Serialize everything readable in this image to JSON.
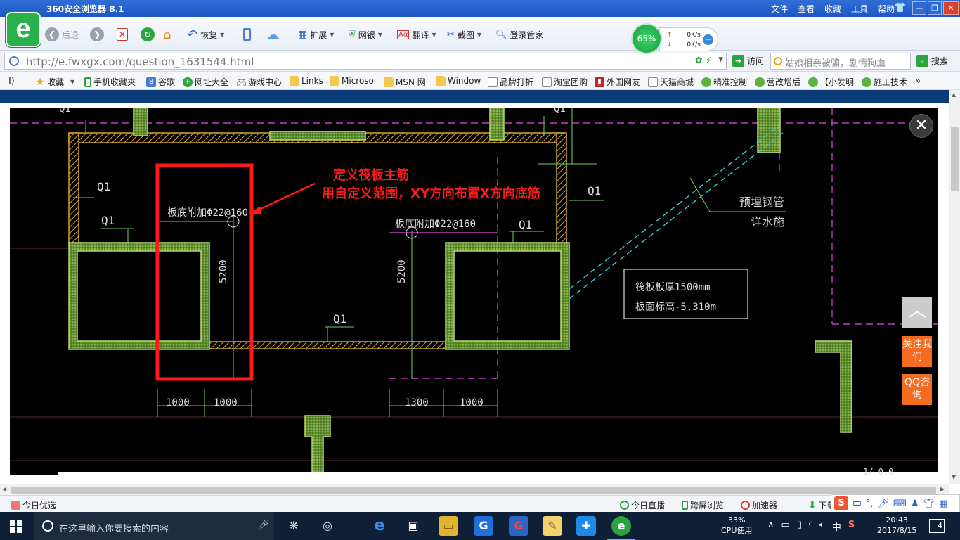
{
  "window": {
    "title": "360安全浏览器 8.1",
    "menu": [
      "文件",
      "查看",
      "收藏",
      "工具",
      "帮助"
    ],
    "logo_letter": "e"
  },
  "toolbar": {
    "back_label": "后退",
    "restore_label": "恢复",
    "extend_label": "扩展",
    "netbank_label": "网银",
    "translate_label": "翻译",
    "screenshot_label": "截图",
    "login_label": "登录管家"
  },
  "net_monitor": {
    "percent": "65%",
    "up_rate": "0K/s",
    "down_rate": "0K/s"
  },
  "address": {
    "url": "http://e.fwxgx.com/question_1631544.html",
    "visit_label": "访问",
    "search_text": "姑娘相亲被骗，剧情狗血",
    "search_label": "搜索"
  },
  "favorites": [
    {
      "label": "收藏",
      "icon": "star-icon"
    },
    {
      "label": "手机收藏夹",
      "icon": "phone-icon"
    },
    {
      "label": "谷歌",
      "icon": "google-icon"
    },
    {
      "label": "网址大全",
      "icon": "plus-icon"
    },
    {
      "label": "游戏中心",
      "icon": "gamepad-icon"
    },
    {
      "label": "Links",
      "icon": "folder-icon"
    },
    {
      "label": "Microso",
      "icon": "folder-icon"
    },
    {
      "label": "MSN 网",
      "icon": "folder-icon"
    },
    {
      "label": "Window",
      "icon": "folder-icon"
    },
    {
      "label": "品牌打折",
      "icon": "page-icon"
    },
    {
      "label": "淘宝团购",
      "icon": "page-icon"
    },
    {
      "label": "外国网友",
      "icon": "flag-icon"
    },
    {
      "label": "天猫商城",
      "icon": "page-icon"
    },
    {
      "label": "精准控制",
      "icon": "wechat-icon"
    },
    {
      "label": "营改增后",
      "icon": "wechat-icon"
    },
    {
      "label": "【小发明",
      "icon": "wechat-icon"
    },
    {
      "label": "施工技术",
      "icon": "wechat-icon"
    }
  ],
  "cad": {
    "annotation_title": "定义筏板主筋",
    "annotation_body": "用自定义范围，XY方向布置X方向底筋",
    "rebar_left": "板底附加Φ22@160",
    "rebar_right": "板底附加Φ22@160",
    "wall_label": "Q1",
    "dim_5200": "5200",
    "dim_1000": "1000",
    "dim_1300": "1300",
    "pipe_line1": "预埋钢管",
    "pipe_line2": "详水施",
    "note_line1": "筏板板厚1500mm",
    "note_line2": "板面标高-5.310m",
    "corner_text": "1/ 0.0"
  },
  "page_side": {
    "close_glyph": "✕",
    "top_glyph": "︿",
    "follow_label": "关注我们",
    "qq_label": "QQ咨询"
  },
  "statusbar": {
    "left_label": "今日优选",
    "live_label": "今日直播",
    "cross_label": "跨屏浏览",
    "accel_label": "加速器",
    "download_label": "下载"
  },
  "ime": {
    "logo": "S",
    "lang": "中"
  },
  "taskbar": {
    "search_placeholder": "在这里输入你要搜索的内容",
    "cpu_percent": "33%",
    "cpu_label": "CPU使用",
    "ime_label": "中",
    "time": "20:43",
    "date": "2017/8/15",
    "notifications": "4"
  }
}
